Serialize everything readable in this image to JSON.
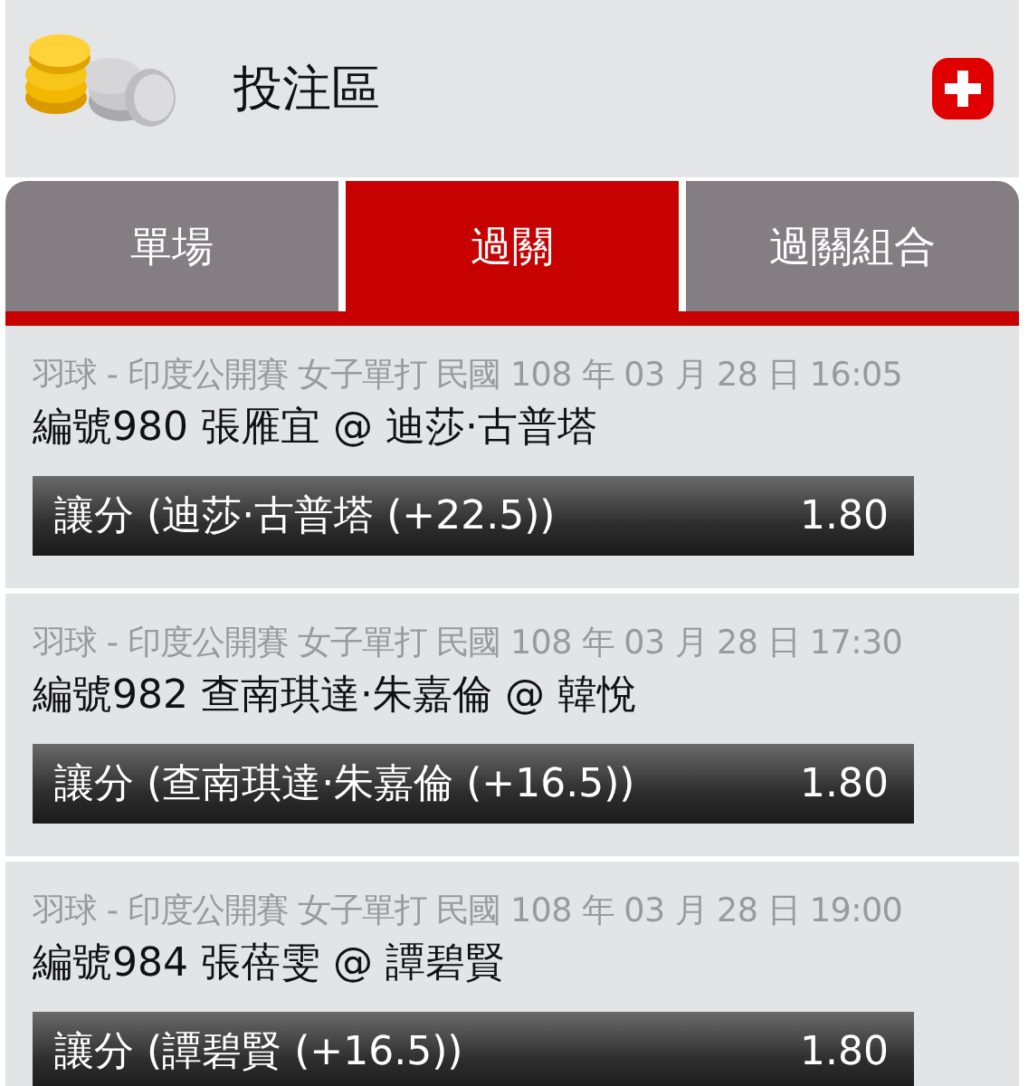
{
  "header": {
    "title": "投注區"
  },
  "tabs": [
    {
      "label": "單場",
      "selected": false
    },
    {
      "label": "過關",
      "selected": true
    },
    {
      "label": "過關組合",
      "selected": false
    }
  ],
  "events": [
    {
      "meta": "羽球 - 印度公開賽 女子單打 民國 108 年 03 月 28 日 16:05",
      "match": "編號980 張雁宜 @ 迪莎·古普塔",
      "bet": "讓分 (迪莎·古普塔 (+22.5))",
      "odds": "1.80"
    },
    {
      "meta": "羽球 - 印度公開賽 女子單打 民國 108 年 03 月 28 日 17:30",
      "match": "編號982 查南琪達·朱嘉倫 @ 韓悅",
      "bet": "讓分 (查南琪達·朱嘉倫 (+16.5))",
      "odds": "1.80"
    },
    {
      "meta": "羽球 - 印度公開賽 女子單打 民國 108 年 03 月 28 日 19:00",
      "match": "編號984 張蓓雯 @ 譚碧賢",
      "bet": "讓分 (譚碧賢 (+16.5))",
      "odds": "1.80"
    }
  ]
}
